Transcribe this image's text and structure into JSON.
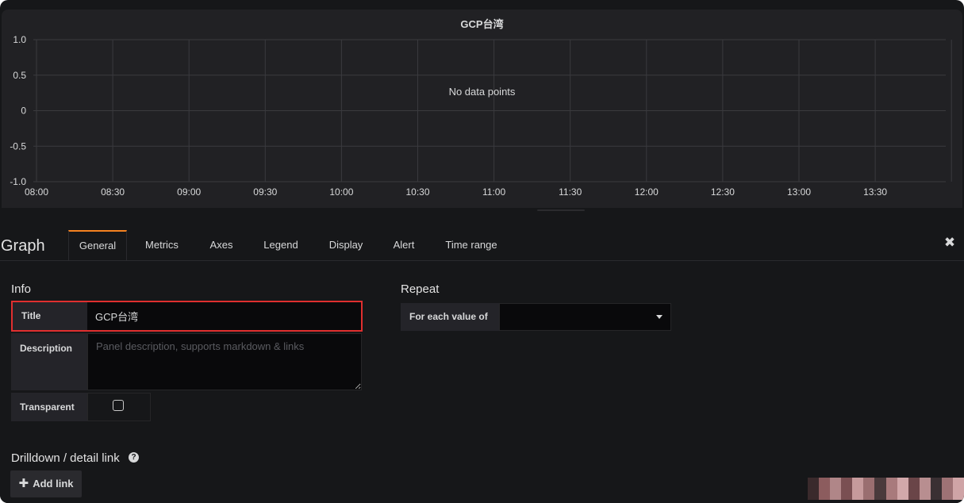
{
  "graph": {
    "title": "GCP台湾",
    "no_data_text": "No data points",
    "y_ticks": [
      "1.0",
      "0.5",
      "0",
      "-0.5",
      "-1.0"
    ],
    "x_ticks": [
      "08:00",
      "08:30",
      "09:00",
      "09:30",
      "10:00",
      "10:30",
      "11:00",
      "11:30",
      "12:00",
      "12:30",
      "13:00",
      "13:30"
    ]
  },
  "editor": {
    "panel_type": "Graph",
    "tabs": [
      "General",
      "Metrics",
      "Axes",
      "Legend",
      "Display",
      "Alert",
      "Time range"
    ],
    "active_tab": "General",
    "info": {
      "heading": "Info",
      "title_label": "Title",
      "title_value": "GCP台湾",
      "description_label": "Description",
      "description_placeholder": "Panel description, supports markdown & links",
      "transparent_label": "Transparent",
      "transparent_checked": false
    },
    "repeat": {
      "heading": "Repeat",
      "for_each_label": "For each value of",
      "for_each_value": ""
    },
    "drilldown": {
      "heading": "Drilldown / detail link",
      "add_link_label": "Add link"
    }
  },
  "colors": {
    "accent_tab": "#f58220",
    "highlight_border": "#e02f2f",
    "panel_bg": "#212124",
    "page_bg": "#161719"
  }
}
